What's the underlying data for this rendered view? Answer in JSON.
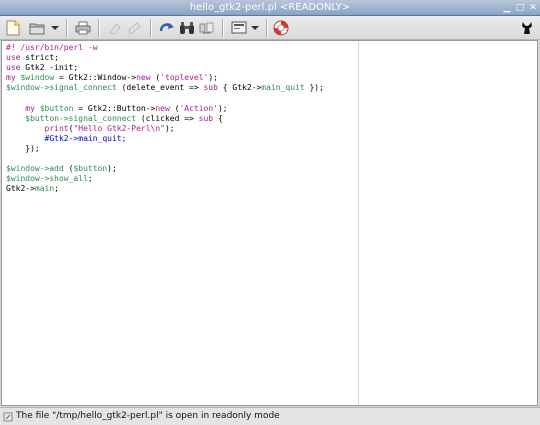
{
  "window": {
    "title": "hello_gtk2-perl.pl <READONLY>"
  },
  "toolbar": {
    "icons": [
      "new-file-icon",
      "open-file-icon",
      "dropdown-icon",
      "print-icon",
      "undo-icon",
      "redo-icon",
      "reload-icon",
      "find-icon",
      "replace-icon",
      "view-icon",
      "dropdown-icon",
      "help-icon",
      "gnu-icon"
    ]
  },
  "editor": {
    "lines": [
      [
        {
          "t": "#! /usr/bin/perl -w",
          "c": "#b02090"
        }
      ],
      [
        {
          "t": "use",
          "c": "#a0208a"
        },
        {
          "t": " strict;",
          "c": "#000000"
        }
      ],
      [
        {
          "t": "use",
          "c": "#a0208a"
        },
        {
          "t": " Gtk2 -init;",
          "c": "#000000"
        }
      ],
      [
        {
          "t": "my",
          "c": "#a0208a"
        },
        {
          "t": " ",
          "c": "#000000"
        },
        {
          "t": "$window",
          "c": "#2e8b57"
        },
        {
          "t": " = Gtk2::Window->",
          "c": "#000000"
        },
        {
          "t": "new",
          "c": "#a0208a"
        },
        {
          "t": " (",
          "c": "#000000"
        },
        {
          "t": "'toplevel'",
          "c": "#b02090"
        },
        {
          "t": ");",
          "c": "#000000"
        }
      ],
      [
        {
          "t": "$window->signal_connect",
          "c": "#2e8b57"
        },
        {
          "t": " (delete_event => ",
          "c": "#000000"
        },
        {
          "t": "sub",
          "c": "#a0208a"
        },
        {
          "t": " { Gtk2->",
          "c": "#000000"
        },
        {
          "t": "main_quit",
          "c": "#2e8b57"
        },
        {
          "t": " });",
          "c": "#000000"
        }
      ],
      [
        {
          "t": "",
          "c": "#000000"
        }
      ],
      [
        {
          "t": "    ",
          "c": "#000000"
        },
        {
          "t": "my",
          "c": "#a0208a"
        },
        {
          "t": " ",
          "c": "#000000"
        },
        {
          "t": "$button",
          "c": "#2e8b57"
        },
        {
          "t": " = Gtk2::Button->",
          "c": "#000000"
        },
        {
          "t": "new",
          "c": "#a0208a"
        },
        {
          "t": " (",
          "c": "#000000"
        },
        {
          "t": "'Action'",
          "c": "#b02090"
        },
        {
          "t": ");",
          "c": "#000000"
        }
      ],
      [
        {
          "t": "    ",
          "c": "#000000"
        },
        {
          "t": "$button->signal_connect",
          "c": "#2e8b57"
        },
        {
          "t": " (clicked => ",
          "c": "#000000"
        },
        {
          "t": "sub",
          "c": "#a0208a"
        },
        {
          "t": " {",
          "c": "#000000"
        }
      ],
      [
        {
          "t": "        ",
          "c": "#000000"
        },
        {
          "t": "print",
          "c": "#a0208a"
        },
        {
          "t": "(",
          "c": "#000000"
        },
        {
          "t": "\"Hello Gtk2-Perl\\n\"",
          "c": "#b02090"
        },
        {
          "t": ");",
          "c": "#000000"
        }
      ],
      [
        {
          "t": "        ",
          "c": "#000000"
        },
        {
          "t": "#Gtk2->main_quit;",
          "c": "#0000cd"
        }
      ],
      [
        {
          "t": "    });",
          "c": "#000000"
        }
      ],
      [
        {
          "t": "",
          "c": "#000000"
        }
      ],
      [
        {
          "t": "$window->add",
          "c": "#2e8b57"
        },
        {
          "t": " (",
          "c": "#000000"
        },
        {
          "t": "$button",
          "c": "#2e8b57"
        },
        {
          "t": ");",
          "c": "#000000"
        }
      ],
      [
        {
          "t": "$window->show_all",
          "c": "#2e8b57"
        },
        {
          "t": ";",
          "c": "#000000"
        }
      ],
      [
        {
          "t": "Gtk2->",
          "c": "#000000"
        },
        {
          "t": "main",
          "c": "#2e8b57"
        },
        {
          "t": ";",
          "c": "#000000"
        }
      ]
    ]
  },
  "status": {
    "message": "The file \"/tmp/hello_gtk2-perl.pl\" is open in readonly mode"
  }
}
